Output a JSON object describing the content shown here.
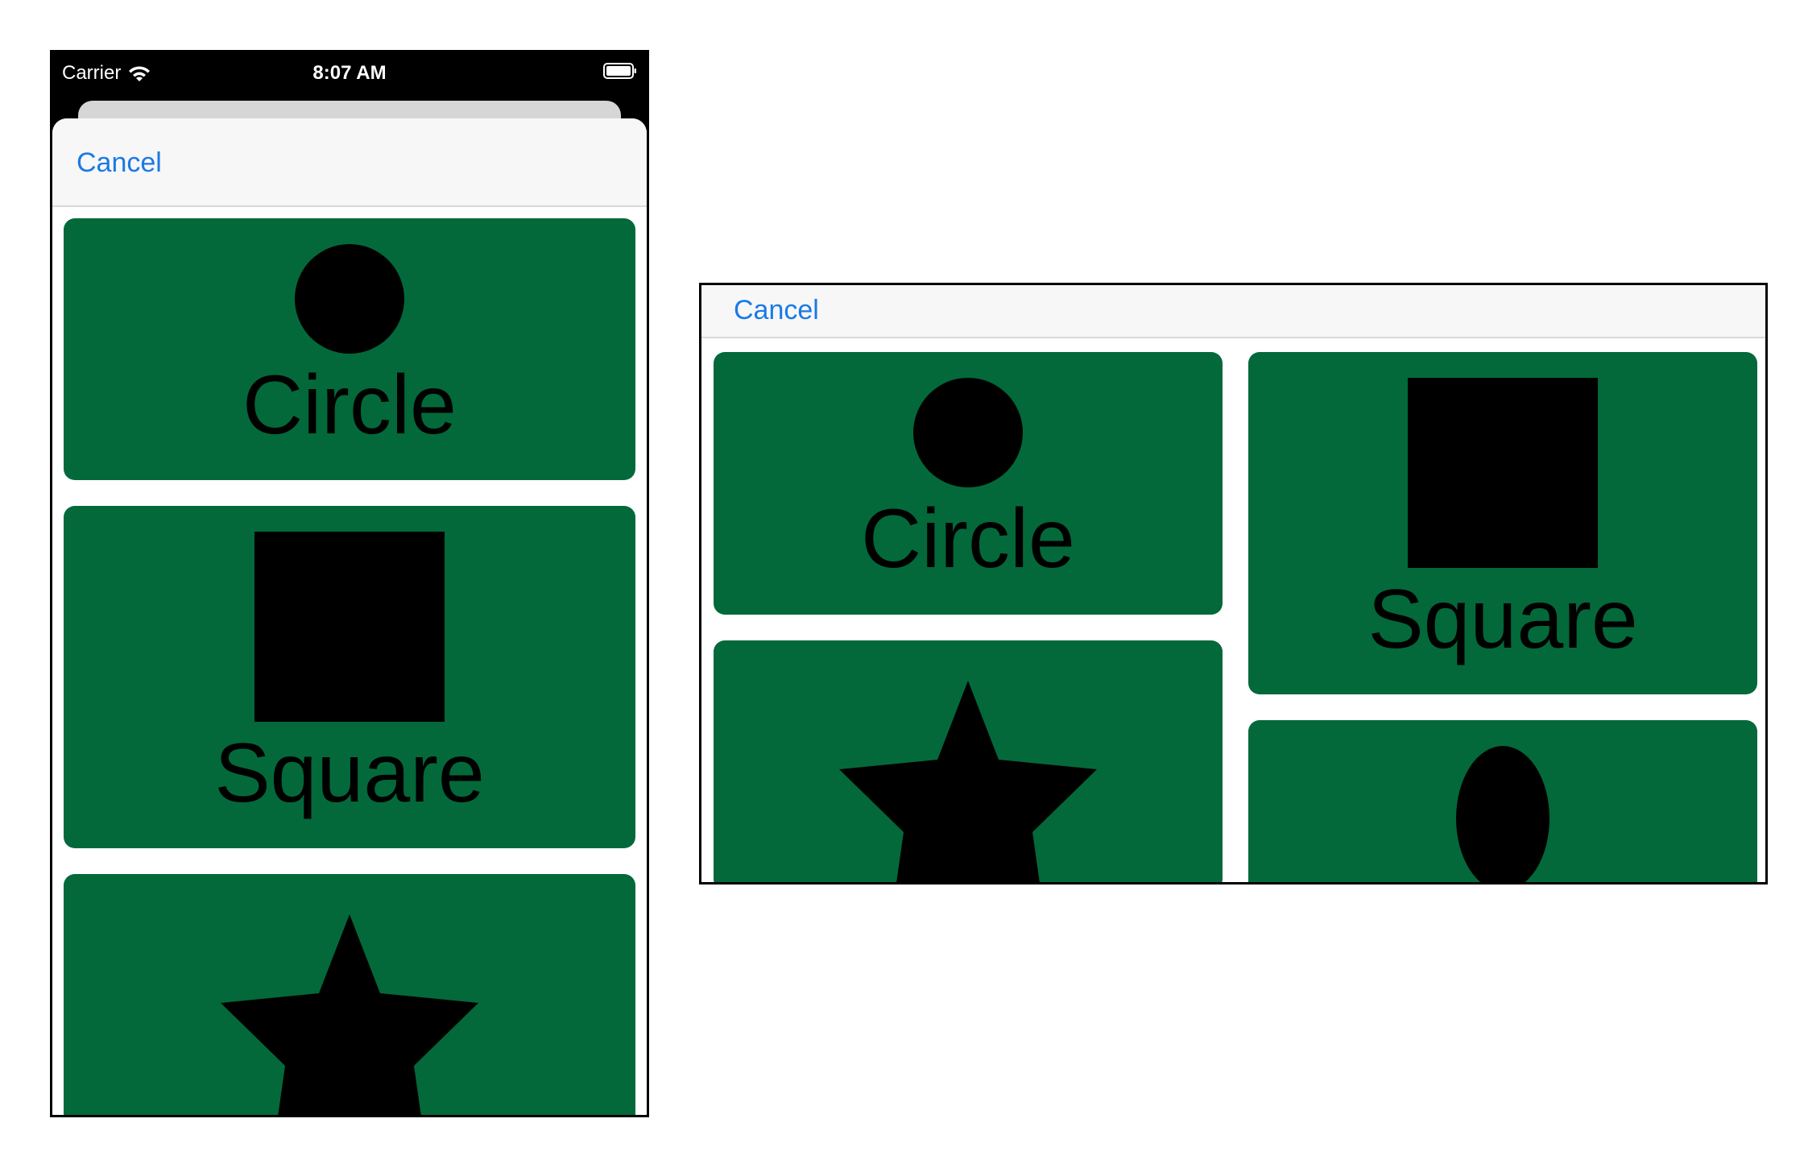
{
  "status_bar": {
    "carrier": "Carrier",
    "time": "8:07 AM"
  },
  "sheet": {
    "cancel_label": "Cancel"
  },
  "tiles": {
    "circle": "Circle",
    "square": "Square"
  },
  "icons": [
    "wifi-icon",
    "battery-icon",
    "circle-shape",
    "square-shape",
    "star-shape",
    "oval-shape"
  ],
  "colors": {
    "tile_background": "#03693a",
    "link_blue": "#1a7ae5",
    "nav_background": "#f7f7f7",
    "status_bar_background": "#000000"
  }
}
